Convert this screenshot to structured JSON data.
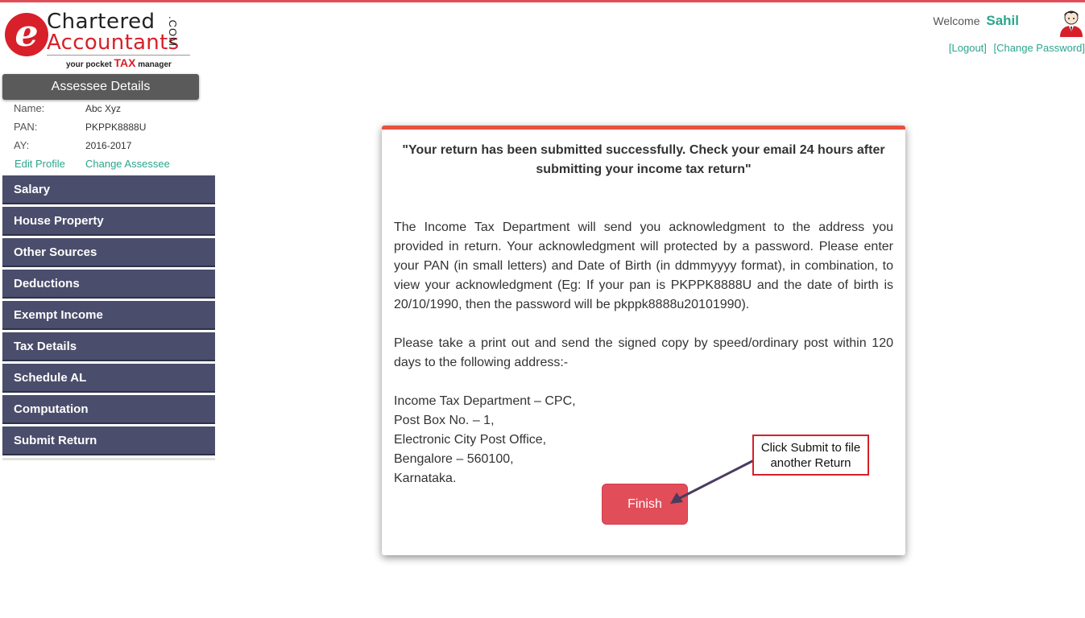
{
  "brand": {
    "logo_e": "e",
    "line1": "Chartered",
    "line2": "Accountants",
    "dotcom": ".COM",
    "tagline_pre": "your pocket",
    "tagline_tax": "TAX",
    "tagline_post": "manager"
  },
  "header": {
    "welcome_label": "Welcome",
    "user_name": "Sahil",
    "logout_label": "[Logout]",
    "change_password_label": "[Change Password]",
    "avatar_icon": "user-avatar-icon"
  },
  "sidebar": {
    "assessee_header": "Assessee Details",
    "name_label": "Name:",
    "name_value": "Abc Xyz",
    "pan_label": "PAN:",
    "pan_value": "PKPPK8888U",
    "ay_label": "AY:",
    "ay_value": "2016-2017",
    "edit_profile_label": "Edit Profile",
    "change_assessee_label": "Change Assessee",
    "menu": [
      {
        "label": "Salary"
      },
      {
        "label": "House Property"
      },
      {
        "label": "Other Sources"
      },
      {
        "label": "Deductions"
      },
      {
        "label": "Exempt Income"
      },
      {
        "label": "Tax Details"
      },
      {
        "label": "Schedule AL"
      },
      {
        "label": "Computation"
      },
      {
        "label": "Submit Return"
      }
    ]
  },
  "card": {
    "title": "\"Your return has been submitted successfully. Check your email 24 hours after submitting your income tax return\"",
    "para1": "The Income Tax Department will send you acknowledgment to the address you provided in return. Your acknowledgment will protected by a password. Please enter your PAN (in small letters) and Date of Birth (in ddmmyyyy format), in combination, to view your acknowledgment (Eg: If your pan is PKPPK8888U and the date of birth is 20/10/1990, then the password will be pkppk8888u20101990).",
    "para2": "Please take a print out and send the signed copy by speed/ordinary post within 120 days to the following address:-",
    "address": [
      "Income Tax Department – CPC,",
      "Post Box No. – 1,",
      "Electronic City Post Office,",
      "Bengalore – 560100,",
      "Karnataka."
    ],
    "finish_label": "Finish"
  },
  "callout": {
    "text_line1": "Click Submit to file",
    "text_line2": "another Return"
  },
  "colors": {
    "accent_red": "#e24d5a",
    "menu_bg": "#4a4d6b",
    "link_green": "#2ba58d"
  }
}
